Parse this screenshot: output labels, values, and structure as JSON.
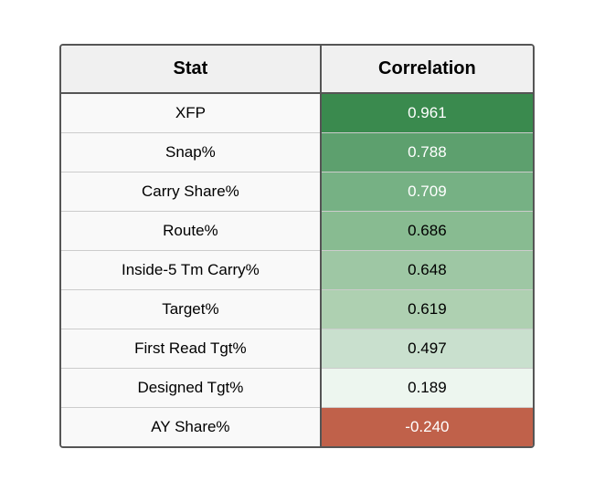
{
  "table": {
    "header": {
      "stat_label": "Stat",
      "correlation_label": "Correlation"
    },
    "rows": [
      {
        "stat": "XFP",
        "correlation": "0.961",
        "color_class": "color-0"
      },
      {
        "stat": "Snap%",
        "correlation": "0.788",
        "color_class": "color-1"
      },
      {
        "stat": "Carry Share%",
        "correlation": "0.709",
        "color_class": "color-2"
      },
      {
        "stat": "Route%",
        "correlation": "0.686",
        "color_class": "color-3"
      },
      {
        "stat": "Inside-5 Tm Carry%",
        "correlation": "0.648",
        "color_class": "color-4"
      },
      {
        "stat": "Target%",
        "correlation": "0.619",
        "color_class": "color-5"
      },
      {
        "stat": "First Read Tgt%",
        "correlation": "0.497",
        "color_class": "color-6"
      },
      {
        "stat": "Designed Tgt%",
        "correlation": "0.189",
        "color_class": "color-7"
      },
      {
        "stat": "AY Share%",
        "correlation": "-0.240",
        "color_class": "color-8"
      }
    ]
  }
}
